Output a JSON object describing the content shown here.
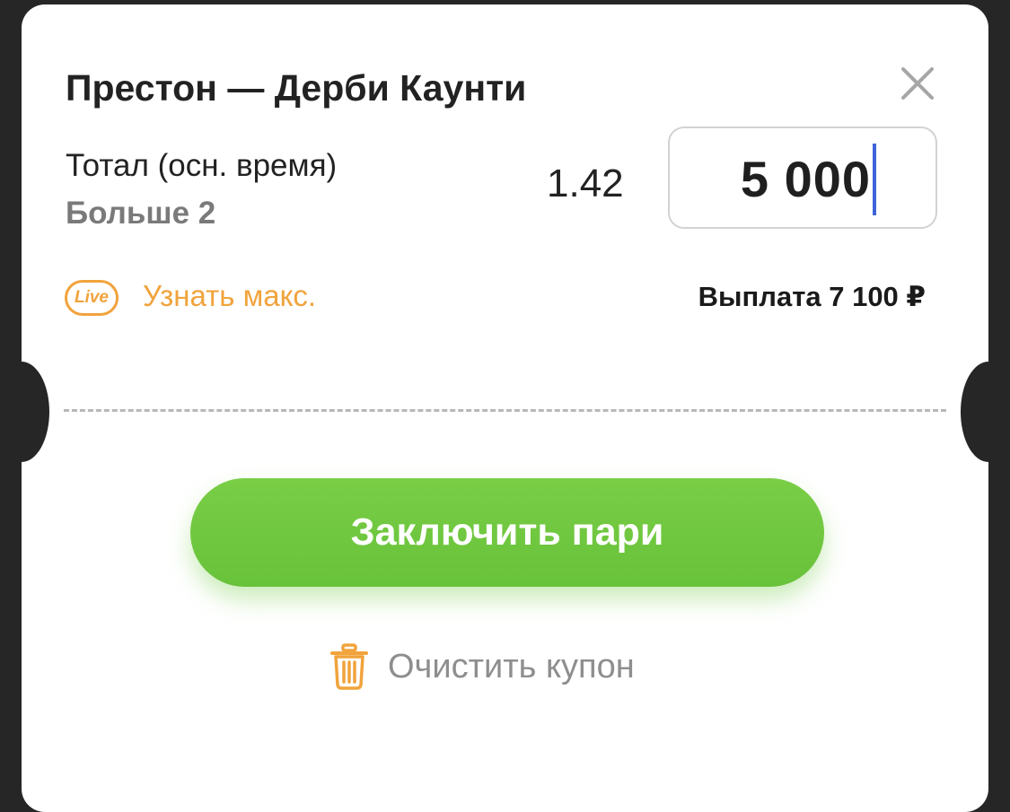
{
  "coupon": {
    "match_title": "Престон — Дерби Каунти",
    "market": "Тотал (осн. время)",
    "outcome": "Больше 2",
    "odds": "1.42",
    "stake": "5 000",
    "live_badge": "Live",
    "max_link": "Узнать макс.",
    "payout": "Выплата 7 100 ₽"
  },
  "actions": {
    "place_bet": "Заключить пари",
    "clear_coupon": "Очистить купон"
  },
  "icons": {
    "close": "close-icon",
    "trash": "trash-icon"
  },
  "colors": {
    "accent_orange": "#F1A33C",
    "button_green": "#6CC53C",
    "caret_blue": "#3F63D8",
    "muted_gray": "#8E8E8E"
  }
}
